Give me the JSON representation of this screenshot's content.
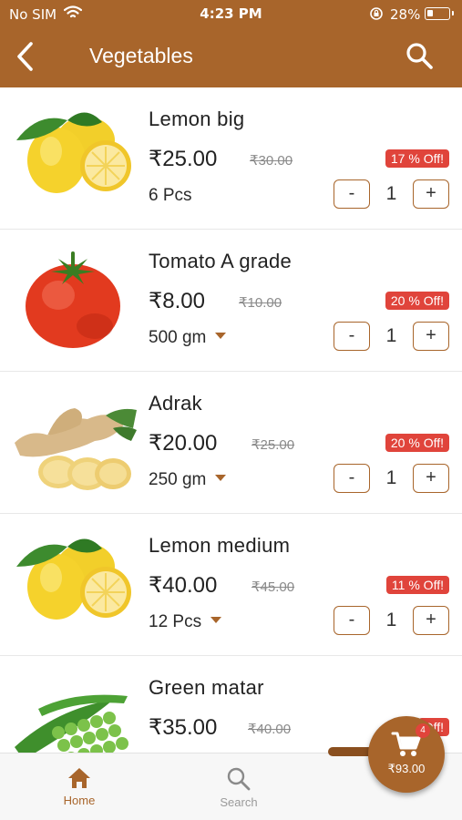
{
  "status_bar": {
    "carrier": "No SIM",
    "time": "4:23 PM",
    "battery": "28%",
    "battery_level": 0.28
  },
  "nav": {
    "title": "Vegetables",
    "back_icon": "chevron-left-icon",
    "search_icon": "search-icon"
  },
  "products": [
    {
      "name": "Lemon big",
      "price": "₹25.00",
      "mrp": "₹30.00",
      "discount": "17 % Off!",
      "unit": "6 Pcs",
      "has_unit_dropdown": false,
      "qty": "1",
      "minus": "-",
      "plus": "+"
    },
    {
      "name": "Tomato A grade",
      "price": "₹8.00",
      "mrp": "₹10.00",
      "discount": "20 % Off!",
      "unit": "500 gm",
      "has_unit_dropdown": true,
      "qty": "1",
      "minus": "-",
      "plus": "+"
    },
    {
      "name": "Adrak",
      "price": "₹20.00",
      "mrp": "₹25.00",
      "discount": "20 % Off!",
      "unit": "250 gm",
      "has_unit_dropdown": true,
      "qty": "1",
      "minus": "-",
      "plus": "+"
    },
    {
      "name": "Lemon medium",
      "price": "₹40.00",
      "mrp": "₹45.00",
      "discount": "11 % Off!",
      "unit": "12 Pcs",
      "has_unit_dropdown": true,
      "qty": "1",
      "minus": "-",
      "plus": "+"
    },
    {
      "name": "Green matar",
      "price": "₹35.00",
      "mrp": "₹40.00",
      "discount": "Off!"
    }
  ],
  "tabs": [
    {
      "label": "Home",
      "icon": "home-icon",
      "active": true
    },
    {
      "label": "Search",
      "icon": "search-icon",
      "active": false
    }
  ],
  "cart": {
    "count": "4",
    "total": "₹93.00",
    "icon": "cart-icon"
  },
  "colors": {
    "brand": "#a8652b",
    "discount": "#e0443b"
  }
}
